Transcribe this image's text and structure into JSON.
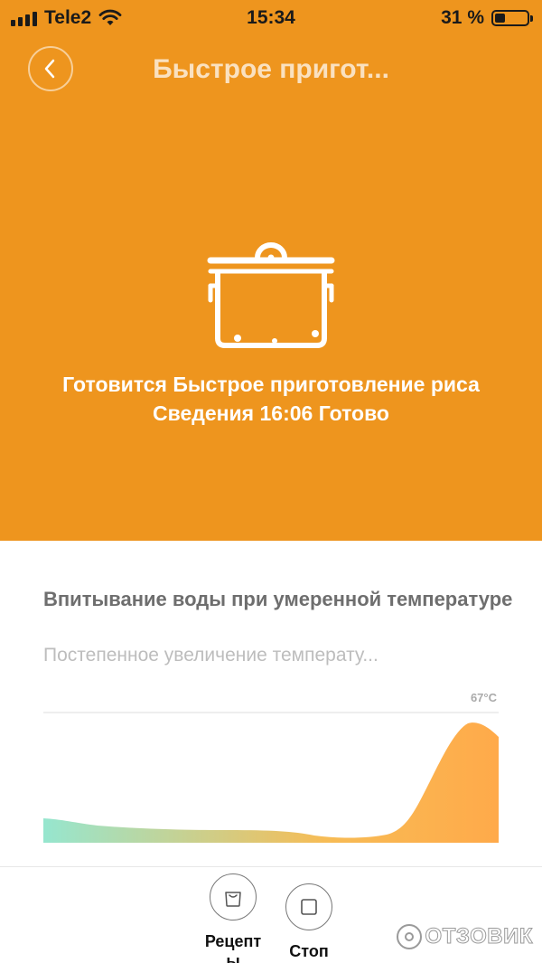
{
  "status_bar": {
    "carrier": "Tele2",
    "time": "15:34",
    "battery_percent": "31 %",
    "battery_level": 0.31
  },
  "header": {
    "title": "Быстрое пригот..."
  },
  "cooking": {
    "status_line1": "Готовится Быстрое приготовление риса",
    "status_line2": "Сведения 16:06 Готово"
  },
  "stage": {
    "title": "Впитывание воды при умеренной температуре",
    "description": "Постепенное увеличение температу..."
  },
  "temp_chart": {
    "peak_label": "67°C",
    "type": "area",
    "gradient_colors": [
      "#96E6CF",
      "#F7BC55",
      "#FFAA4A"
    ]
  },
  "toolbar": {
    "recipes_label": "Рецепты",
    "stop_label": "Стоп"
  },
  "watermark": {
    "text": "ОТЗОВИК"
  },
  "colors": {
    "accent": "#EE951E",
    "text_dark": "#111111",
    "text_gray": "#6E6E6E",
    "text_light": "#BDBDBD"
  }
}
